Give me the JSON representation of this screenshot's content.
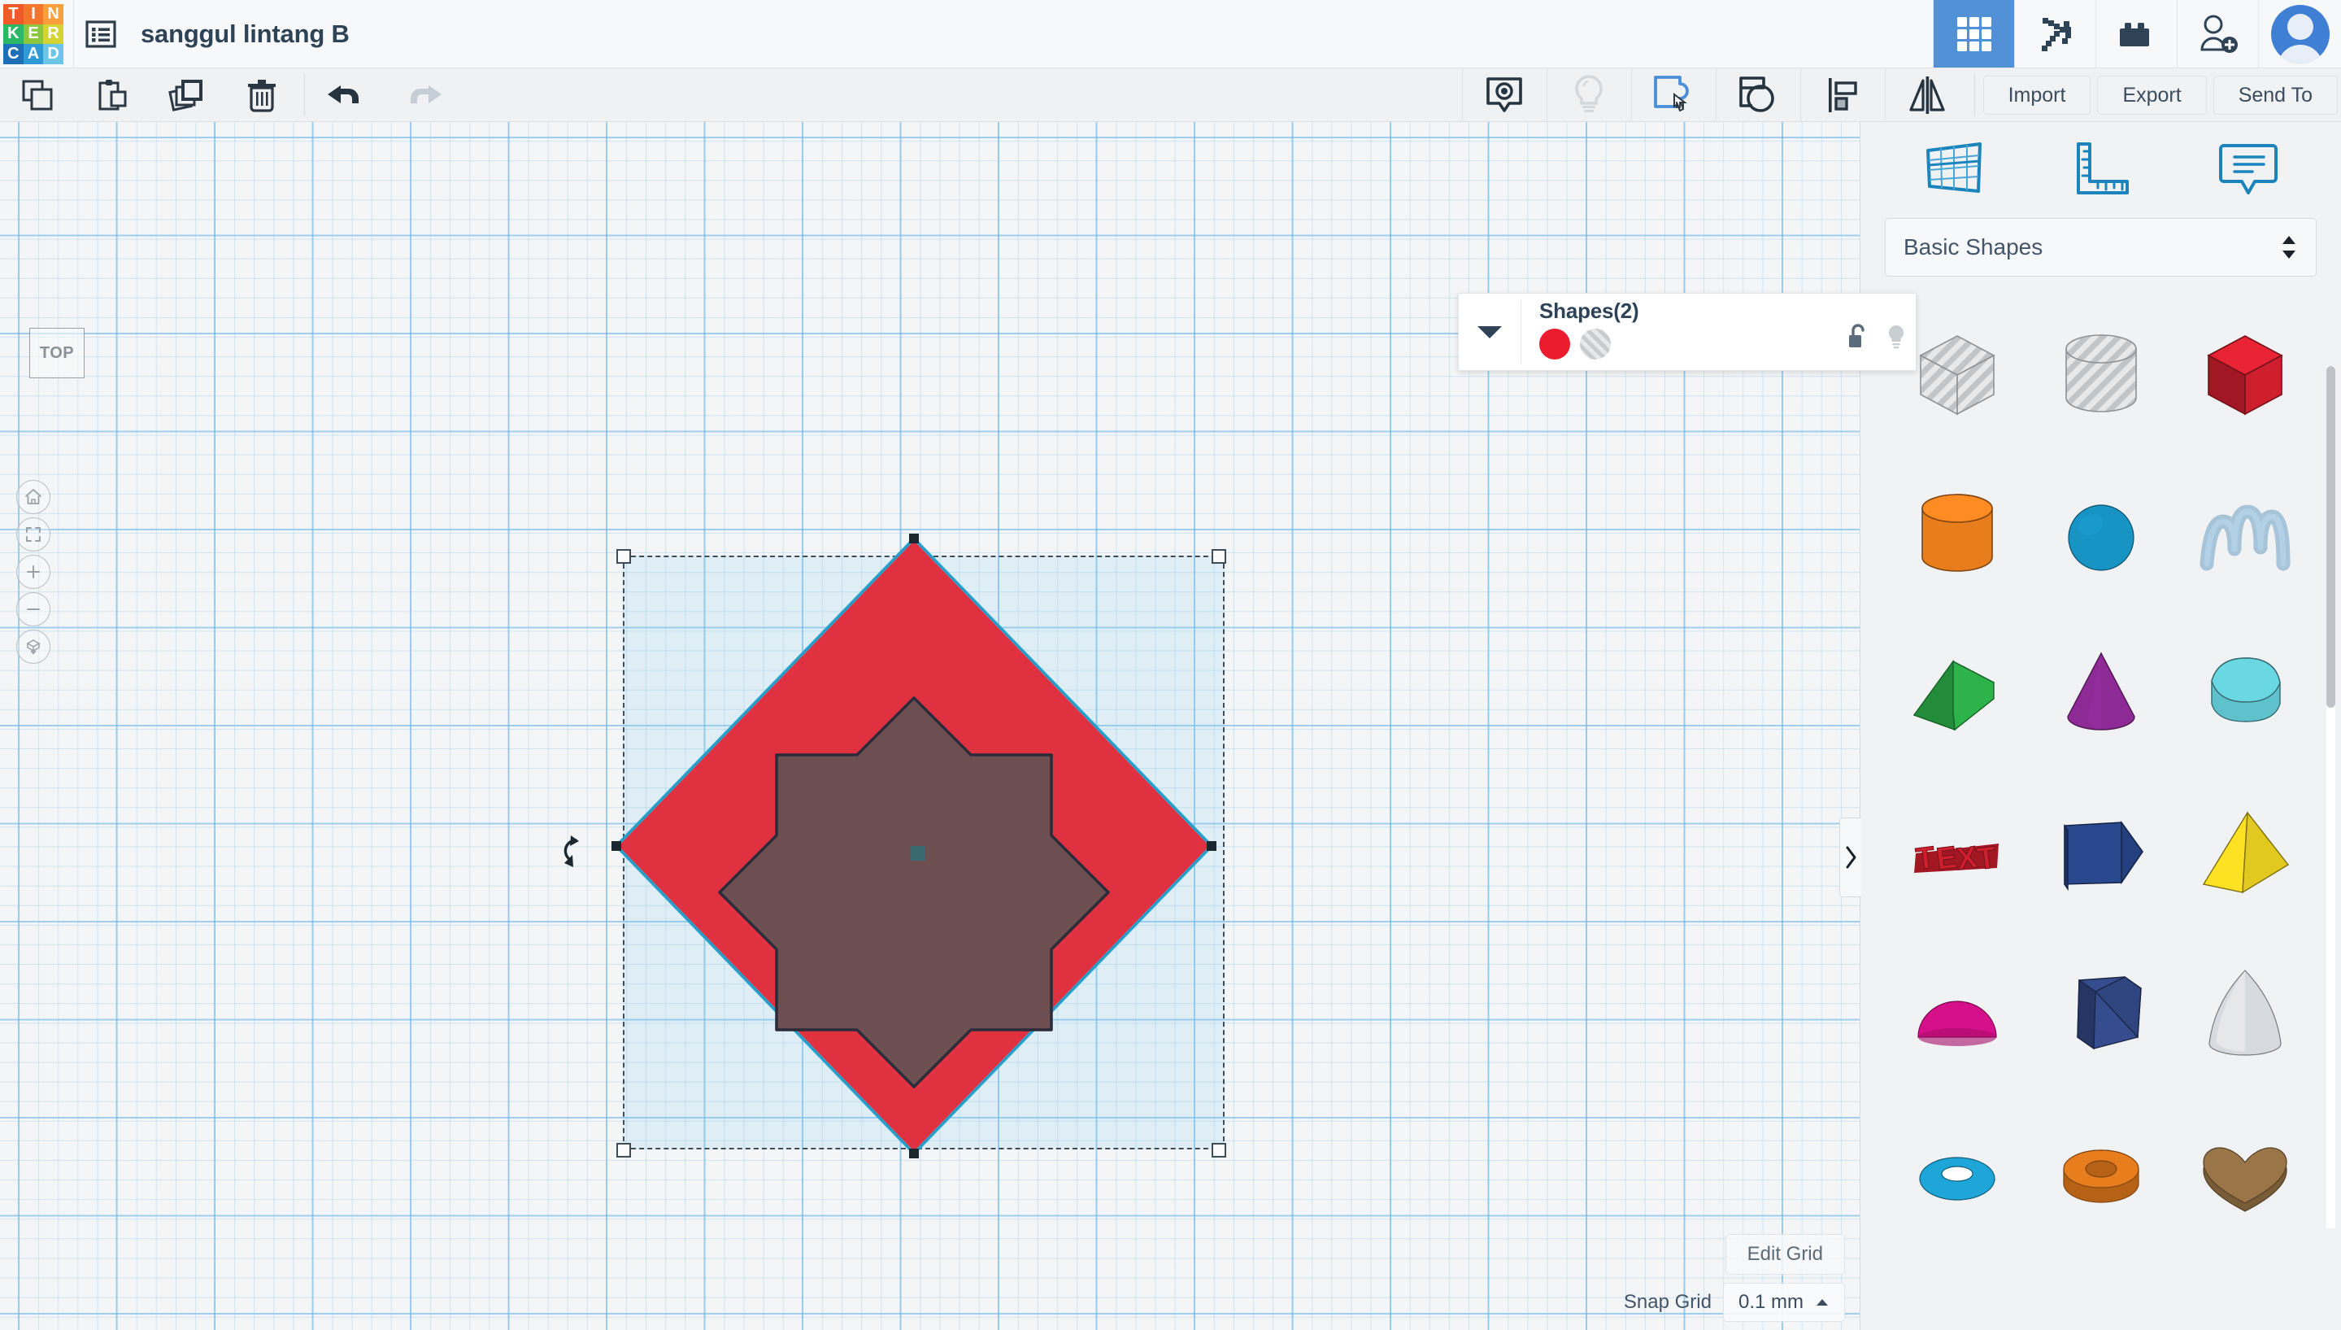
{
  "header": {
    "logo_letters": [
      "T",
      "I",
      "N",
      "K",
      "E",
      "R",
      "C",
      "A",
      "D"
    ],
    "logo_colors": [
      "#f05a28",
      "#f4762c",
      "#f9a03c",
      "#2ab864",
      "#8cc63f",
      "#d3d432",
      "#1d6fb8",
      "#2e9ad6",
      "#6cc6e8"
    ],
    "logo_name": "tinkercad-logo",
    "project_title": "sanggul lintang B",
    "icons": {
      "list": "list-icon",
      "grid": "gallery-grid-icon",
      "blocks": "codeblocks-pickaxe-icon",
      "bricks": "lego-bricks-icon",
      "invite": "invite-person-icon",
      "avatar": "user-avatar"
    }
  },
  "toolbar": {
    "left_buttons": [
      {
        "name": "copy-button",
        "icon": "copy-icon"
      },
      {
        "name": "paste-button",
        "icon": "paste-icon"
      },
      {
        "name": "duplicate-button",
        "icon": "duplicate-icon"
      },
      {
        "name": "delete-button",
        "icon": "trash-icon"
      }
    ],
    "history_buttons": [
      {
        "name": "undo-button",
        "icon": "undo-arrow-icon",
        "enabled": true
      },
      {
        "name": "redo-button",
        "icon": "redo-arrow-icon",
        "enabled": false
      }
    ],
    "right_icons": [
      {
        "name": "note-button",
        "icon": "comment-note-icon",
        "state": "normal"
      },
      {
        "name": "light-button",
        "icon": "lightbulb-icon",
        "state": "disabled"
      },
      {
        "name": "group-button",
        "icon": "group-shapes-icon",
        "state": "active"
      },
      {
        "name": "ungroup-button",
        "icon": "ungroup-shapes-icon",
        "state": "normal"
      },
      {
        "name": "align-button",
        "icon": "align-icon",
        "state": "normal"
      },
      {
        "name": "mirror-button",
        "icon": "mirror-flip-icon",
        "state": "normal"
      }
    ],
    "import_label": "Import",
    "export_label": "Export",
    "sendto_label": "Send To"
  },
  "canvas": {
    "view_cube_label": "TOP",
    "view_controls": [
      {
        "name": "home-view-button",
        "icon": "home-icon"
      },
      {
        "name": "fit-all-button",
        "icon": "fit-to-view-icon"
      },
      {
        "name": "zoom-in-button",
        "icon": "plus-icon"
      },
      {
        "name": "zoom-out-button",
        "icon": "minus-icon"
      },
      {
        "name": "perspective-toggle-button",
        "icon": "cube-perspective-icon"
      }
    ],
    "selection": {
      "diamond_color": "#e03141",
      "star_color": "#6d4f51",
      "selection_tint": "#82cdf0",
      "handle_color": "#3e4c59",
      "rotate_icon": "rotate-handle-icon"
    }
  },
  "shapes_popup": {
    "title": "Shapes(2)",
    "collapse_icon": "caret-down-icon",
    "solid_color": "#ed1b2e",
    "hole_label": "hole-swatch",
    "lock_icon": "unlock-icon",
    "light_icon": "lightbulb-icon"
  },
  "right_panel": {
    "tools": [
      {
        "name": "workplane-tool",
        "icon": "workplane-grid-icon"
      },
      {
        "name": "ruler-tool",
        "icon": "ruler-icon"
      },
      {
        "name": "note-tool",
        "icon": "note-callout-icon"
      }
    ],
    "category_label": "Basic Shapes",
    "category_icon": "stepper-updown-icon",
    "collapse_icon": "chevron-right-icon",
    "shapes": [
      {
        "name": "box-hole",
        "kind": "box",
        "color": "#c9cbcd",
        "hole": true
      },
      {
        "name": "cylinder-hole",
        "kind": "cylinder",
        "color": "#c9cbcd",
        "hole": true
      },
      {
        "name": "box-red",
        "kind": "box",
        "color": "#cf1f2e",
        "hole": false
      },
      {
        "name": "cylinder-orange",
        "kind": "cylinder",
        "color": "#e87d1e",
        "hole": false
      },
      {
        "name": "sphere-blue",
        "kind": "sphere",
        "color": "#1794c4",
        "hole": false
      },
      {
        "name": "scribble",
        "kind": "scribble",
        "color": "#a8c4d8",
        "hole": false
      },
      {
        "name": "wedge-green",
        "kind": "wedge",
        "color": "#2db34a",
        "hole": false
      },
      {
        "name": "cone-purple",
        "kind": "cone",
        "color": "#8e2a95",
        "hole": false
      },
      {
        "name": "roof-teal",
        "kind": "roof",
        "color": "#5fc1cb",
        "hole": false
      },
      {
        "name": "text-red",
        "kind": "text",
        "color": "#cf1f2e",
        "hole": false
      },
      {
        "name": "house-blue",
        "kind": "house",
        "color": "#25407e",
        "hole": false
      },
      {
        "name": "pyramid-yellow",
        "kind": "pyramid",
        "color": "#e2c91f",
        "hole": false
      },
      {
        "name": "dome-pink",
        "kind": "dome",
        "color": "#d6108a",
        "hole": false
      },
      {
        "name": "polygon-blue",
        "kind": "polygon",
        "color": "#2f4580",
        "hole": false
      },
      {
        "name": "paraboloid-white",
        "kind": "paraboloid",
        "color": "#d7dade",
        "hole": false
      },
      {
        "name": "torus-blue",
        "kind": "torus",
        "color": "#1fa6d8",
        "hole": false
      },
      {
        "name": "tube-orange",
        "kind": "tube",
        "color": "#e87d1e",
        "hole": false
      },
      {
        "name": "heart-brown",
        "kind": "heart",
        "color": "#9a7547",
        "hole": false
      }
    ]
  },
  "grid_footer": {
    "edit_grid_label": "Edit Grid",
    "snap_grid_label": "Snap Grid",
    "snap_grid_value": "0.1 mm",
    "snap_caret_icon": "caret-up-icon"
  }
}
